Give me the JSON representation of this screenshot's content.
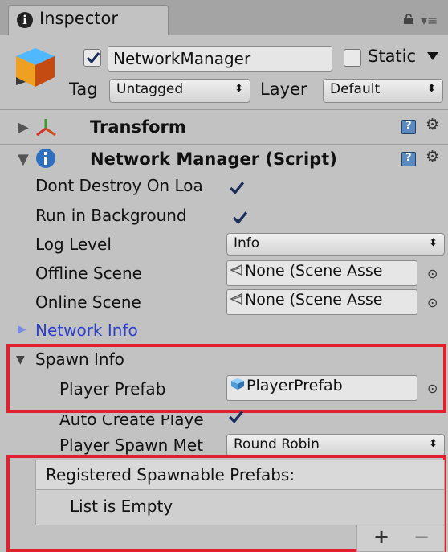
{
  "tab": {
    "title": "Inspector",
    "info_icon": "i"
  },
  "gameobject": {
    "active": true,
    "name": "NetworkManager",
    "static_label": "Static",
    "static": false,
    "tag_label": "Tag",
    "tag_value": "Untagged",
    "layer_label": "Layer",
    "layer_value": "Default"
  },
  "components": [
    {
      "title": "Transform",
      "expanded": false
    },
    {
      "title": "Network Manager (Script)",
      "expanded": true
    }
  ],
  "properties": {
    "dont_destroy": {
      "label": "Dont Destroy On Loa",
      "checked": true
    },
    "run_background": {
      "label": "Run in Background",
      "checked": true
    },
    "log_level": {
      "label": "Log Level",
      "value": "Info"
    },
    "offline_scene": {
      "label": "Offline Scene",
      "value": "None (Scene Asse"
    },
    "online_scene": {
      "label": "Online Scene",
      "value": "None (Scene Asse"
    },
    "network_info": {
      "label": "Network Info"
    },
    "spawn_info": {
      "label": "Spawn Info"
    },
    "player_prefab": {
      "label": "Player Prefab",
      "value": "PlayerPrefab"
    },
    "auto_create": {
      "label": "Auto Create Playe",
      "checked": true
    },
    "spawn_method": {
      "label": "Player Spawn Met",
      "value": "Round Robin"
    }
  },
  "list": {
    "header": "Registered Spawnable Prefabs:",
    "empty_text": "List is Empty",
    "add": "+",
    "remove": "−"
  },
  "colors": {
    "highlight": "#e0202c",
    "link": "#2c3fc9",
    "panel": "#c2c2c2"
  },
  "icons": [
    "info-icon",
    "lock-icon",
    "menu-icon",
    "gameobject-cube-icon",
    "transform-icon",
    "script-icon",
    "help-book-icon",
    "gear-icon",
    "scene-asset-icon",
    "prefab-icon",
    "object-picker-icon"
  ]
}
